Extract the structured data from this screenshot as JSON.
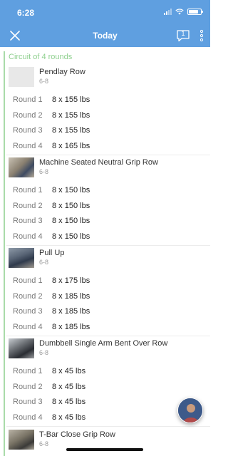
{
  "status": {
    "time": "6:28"
  },
  "nav": {
    "title": "Today",
    "chat_count": "1"
  },
  "circuit": {
    "label": "Circuit of 4 rounds"
  },
  "exercises": [
    {
      "name": "Pendlay Row",
      "reps": "6-8",
      "rounds": [
        {
          "label": "Round 1",
          "value": "8 x 155 lbs"
        },
        {
          "label": "Round 2",
          "value": "8 x 155 lbs"
        },
        {
          "label": "Round 3",
          "value": "8 x 155 lbs"
        },
        {
          "label": "Round 4",
          "value": "8 x 165 lbs"
        }
      ]
    },
    {
      "name": "Machine Seated Neutral Grip Row",
      "reps": "6-8",
      "rounds": [
        {
          "label": "Round 1",
          "value": "8 x 150 lbs"
        },
        {
          "label": "Round 2",
          "value": "8 x 150 lbs"
        },
        {
          "label": "Round 3",
          "value": "8 x 150 lbs"
        },
        {
          "label": "Round 4",
          "value": "8 x 150 lbs"
        }
      ]
    },
    {
      "name": "Pull Up",
      "reps": "6-8",
      "rounds": [
        {
          "label": "Round 1",
          "value": "8 x 175 lbs"
        },
        {
          "label": "Round 2",
          "value": "8 x 185 lbs"
        },
        {
          "label": "Round 3",
          "value": "8 x 185 lbs"
        },
        {
          "label": "Round 4",
          "value": "8 x 185 lbs"
        }
      ]
    },
    {
      "name": "Dumbbell Single Arm Bent Over Row",
      "reps": "6-8",
      "rounds": [
        {
          "label": "Round 1",
          "value": "8 x 45 lbs"
        },
        {
          "label": "Round 2",
          "value": "8 x 45 lbs"
        },
        {
          "label": "Round 3",
          "value": "8 x 45 lbs"
        },
        {
          "label": "Round 4",
          "value": "8 x 45 lbs"
        }
      ]
    },
    {
      "name": "T-Bar Close Grip Row",
      "reps": "6-8",
      "rounds": []
    }
  ],
  "colors": {
    "header": "#5f9fe0",
    "circuit_accent": "#8fd08f"
  },
  "icons": {
    "close": "close-icon",
    "chat": "chat-icon",
    "more": "more-vertical-icon"
  }
}
